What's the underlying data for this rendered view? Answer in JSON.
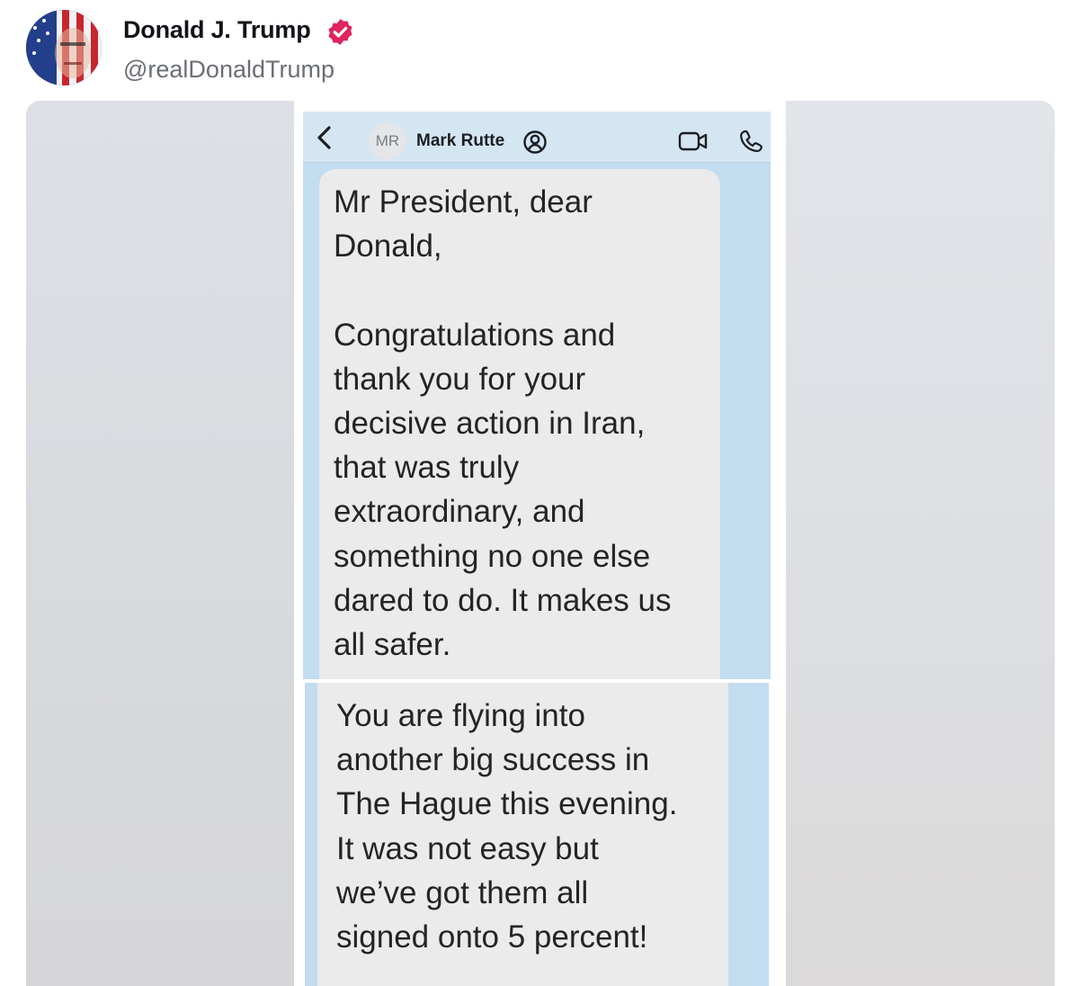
{
  "post": {
    "author_name": "Donald J. Trump",
    "author_handle": "@realDonaldTrump",
    "verified_color": "#e0245e"
  },
  "screenshot": {
    "contact_initials": "MR",
    "contact_name": "Mark Rutte",
    "message_1": "Mr President, dear\nDonald,\n\nCongratulations and\nthank you for your\ndecisive action in Iran,\nthat was truly\nextraordinary, and\nsomething no one else\ndared to do.  It makes us\nall safer.",
    "message_2": "You are flying into\nanother big success in\nThe Hague this evening.\nIt was not easy but\nwe’ve got them all\nsigned onto 5 percent!"
  },
  "icons": {
    "avatar": "profile-photo",
    "verified": "verified-badge-icon",
    "back": "chevron-left-icon",
    "contact_badge": "person-circle-icon",
    "video": "video-camera-icon",
    "phone": "phone-icon"
  }
}
